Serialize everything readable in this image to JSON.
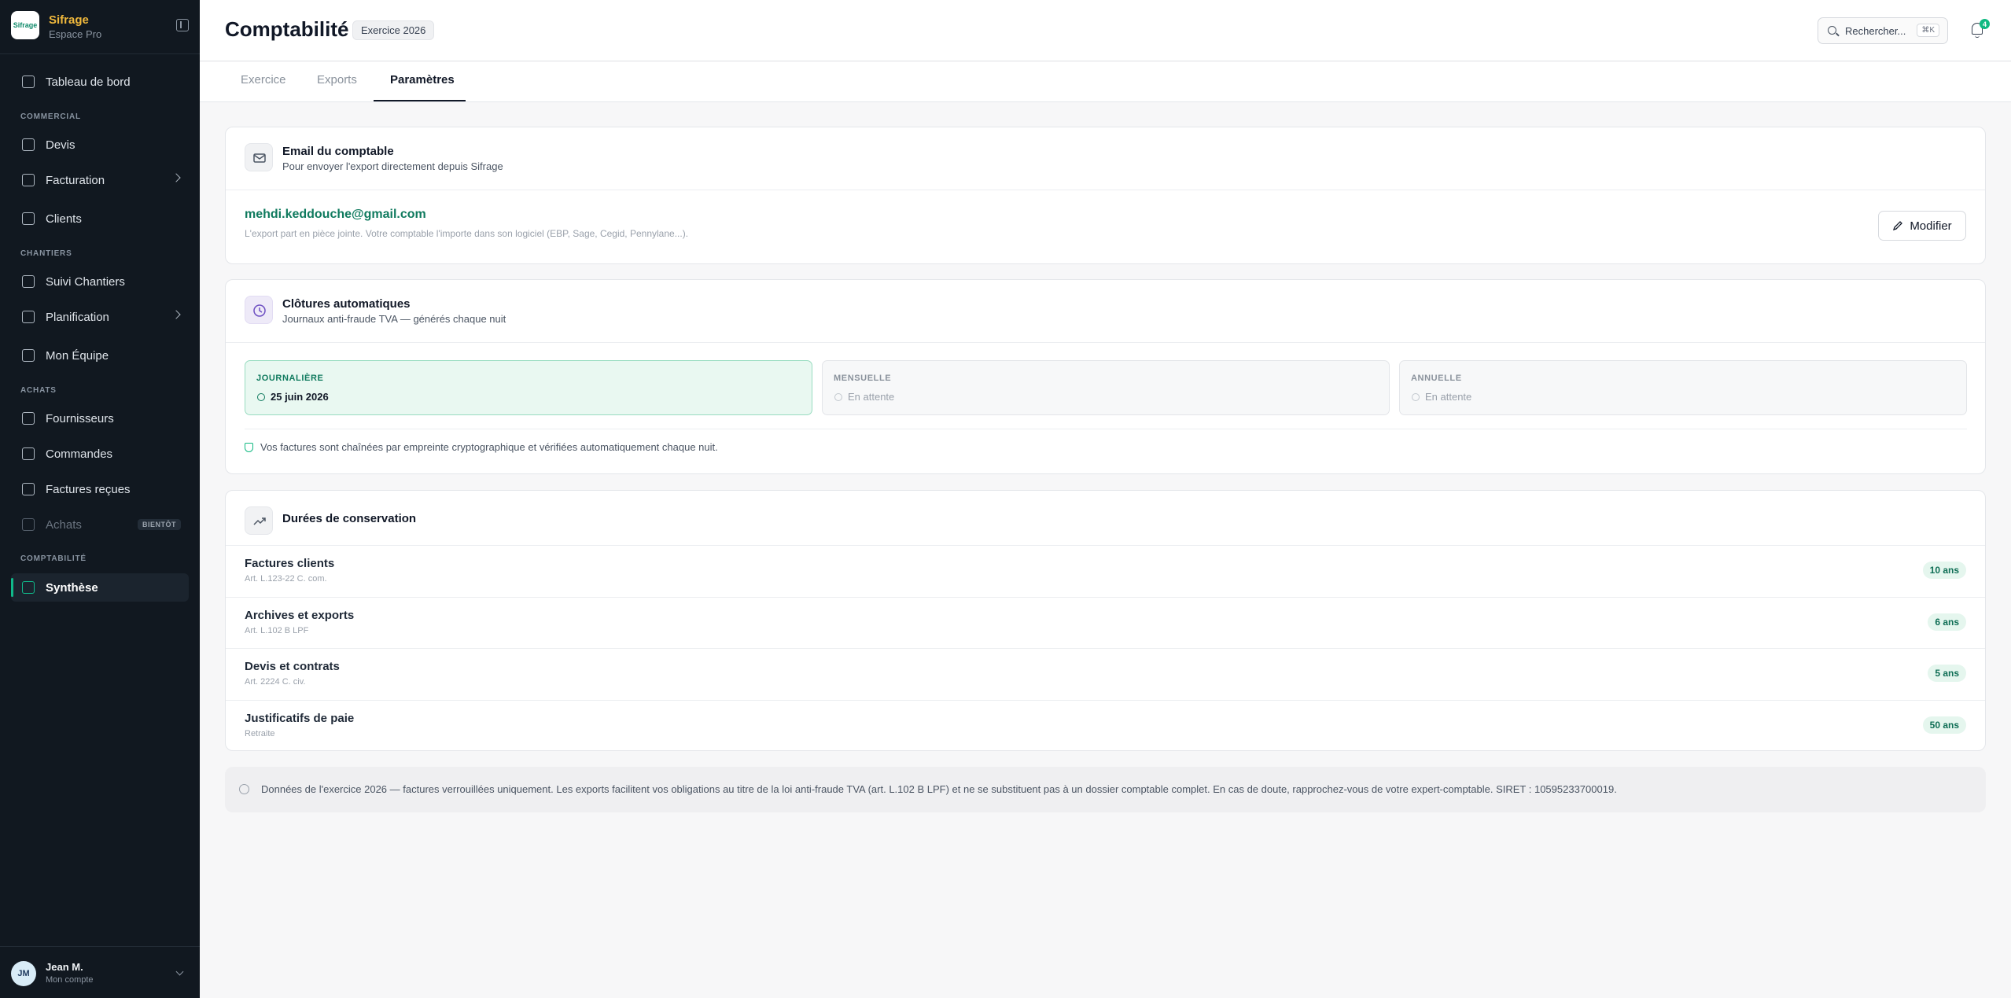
{
  "sidebar": {
    "brand_name": "Sifrage",
    "brand_sub": "Espace Pro",
    "logo_text": "Sifrage",
    "sections": [
      "COMMERCIAL",
      "CHANTIERS",
      "ACHATS",
      "COMPTABILITÉ"
    ],
    "items": [
      {
        "label": "Tableau de bord",
        "icon": "dashboard-icon"
      },
      {
        "label": "Devis",
        "icon": "document-icon"
      },
      {
        "label": "Facturation",
        "icon": "invoice-icon",
        "has_submenu": true
      },
      {
        "label": "Clients",
        "icon": "users-icon"
      },
      {
        "label": "Suivi Chantiers",
        "icon": "construction-icon"
      },
      {
        "label": "Planification",
        "icon": "calendar-icon",
        "has_submenu": true
      },
      {
        "label": "Mon Équipe",
        "icon": "team-icon"
      },
      {
        "label": "Fournisseurs",
        "icon": "truck-icon"
      },
      {
        "label": "Commandes",
        "icon": "clipboard-icon"
      },
      {
        "label": "Factures reçues",
        "icon": "inbox-icon"
      },
      {
        "label": "Achats",
        "icon": "cart-icon",
        "disabled": true,
        "badge": "BIENTÔT"
      },
      {
        "label": "Synthèse",
        "icon": "book-icon",
        "active": true
      }
    ],
    "user": {
      "initials": "JM",
      "name": "Jean M.",
      "sub": "Mon compte"
    }
  },
  "header": {
    "title": "Comptabilité",
    "badge": "Exercice 2026",
    "search_placeholder": "Rechercher...",
    "search_shortcut": "⌘K",
    "notification_count": "4"
  },
  "tabs": [
    {
      "label": "Exercice",
      "active": false
    },
    {
      "label": "Exports",
      "active": false
    },
    {
      "label": "Paramètres",
      "active": true
    }
  ],
  "email_card": {
    "title": "Email du comptable",
    "subtitle": "Pour envoyer l'export directement depuis Sifrage",
    "email": "mehdi.keddouche@gmail.com",
    "note": "L'export part en pièce jointe. Votre comptable l'importe dans son logiciel (EBP, Sage, Cegid, Pennylane...).",
    "button": "Modifier"
  },
  "closures_card": {
    "title": "Clôtures automatiques",
    "subtitle": "Journaux anti-fraude TVA — générés chaque nuit",
    "periods": [
      {
        "label": "JOURNALIÈRE",
        "value": "25 juin 2026",
        "done": true
      },
      {
        "label": "MENSUELLE",
        "value": "En attente",
        "done": false
      },
      {
        "label": "ANNUELLE",
        "value": "En attente",
        "done": false
      }
    ],
    "note": "Vos factures sont chaînées par empreinte cryptographique et vérifiées automatiquement chaque nuit."
  },
  "retention_card": {
    "title": "Durées de conservation",
    "rows": [
      {
        "title": "Factures clients",
        "ref": "Art. L.123-22 C. com.",
        "duration": "10 ans"
      },
      {
        "title": "Archives et exports",
        "ref": "Art. L.102 B LPF",
        "duration": "6 ans"
      },
      {
        "title": "Devis et contrats",
        "ref": "Art. 2224 C. civ.",
        "duration": "5 ans"
      },
      {
        "title": "Justificatifs de paie",
        "ref": "Retraite",
        "duration": "50 ans"
      }
    ]
  },
  "notice": "Données de l'exercice 2026 — factures verrouillées uniquement. Les exports facilitent vos obligations au titre de la loi anti-fraude TVA (art. L.102 B LPF) et ne se substituent pas à un dossier comptable complet. En cas de doute, rapprochez-vous de votre expert-comptable. SIRET : 10595233700019.",
  "colors": {
    "accent": "#10b981",
    "sidebar_bg": "#111820",
    "email_link": "#0f7a5e"
  }
}
